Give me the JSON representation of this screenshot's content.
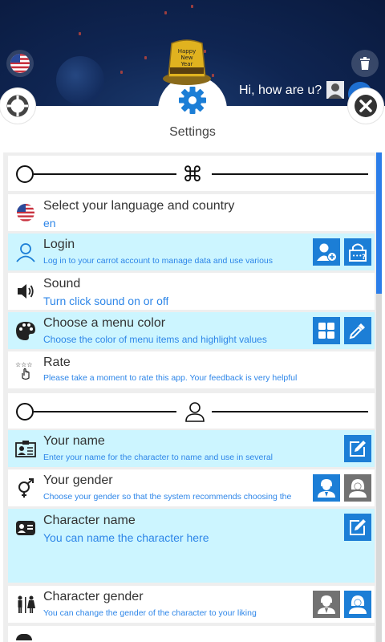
{
  "header": {
    "title": "Settings",
    "greeting": "Hi, how are u?",
    "hat_text": [
      "Happy",
      "New",
      "Year"
    ]
  },
  "icons": {
    "flag": "us-flag-icon",
    "trash": "trash-icon",
    "gear": "gear-icon",
    "close": "close-icon",
    "lifebuoy": "lifebuoy-icon"
  },
  "section_app": {
    "symbol": "⌘"
  },
  "section_user": {
    "symbol": "person"
  },
  "rows": {
    "language": {
      "title": "Select your language and country",
      "subtitle": "en"
    },
    "login": {
      "title": "Login",
      "subtitle": "Log in to your carrot account to manage data and use various"
    },
    "sound": {
      "title": "Sound",
      "subtitle": "Turn click sound on or off"
    },
    "menu_color": {
      "title": "Choose a menu color",
      "subtitle": "Choose the color of menu items and highlight values"
    },
    "rate": {
      "title": "Rate",
      "subtitle": "Please take a moment to rate this app. Your feedback is very helpful"
    },
    "your_name": {
      "title": "Your name",
      "subtitle": "Enter your name for the character to name and use in several"
    },
    "your_gender": {
      "title": "Your gender",
      "subtitle": "Choose your gender so that the system recommends choosing the"
    },
    "character_name": {
      "title": "Character name",
      "subtitle": "You can name the character here"
    },
    "character_gender": {
      "title": "Character gender",
      "subtitle": "You can change the gender of the character to your liking"
    }
  },
  "colors": {
    "accent": "#1c7ed6",
    "highlight": "#ccf5ff",
    "subtitle": "#2e86e8",
    "background": "#0f2552"
  }
}
